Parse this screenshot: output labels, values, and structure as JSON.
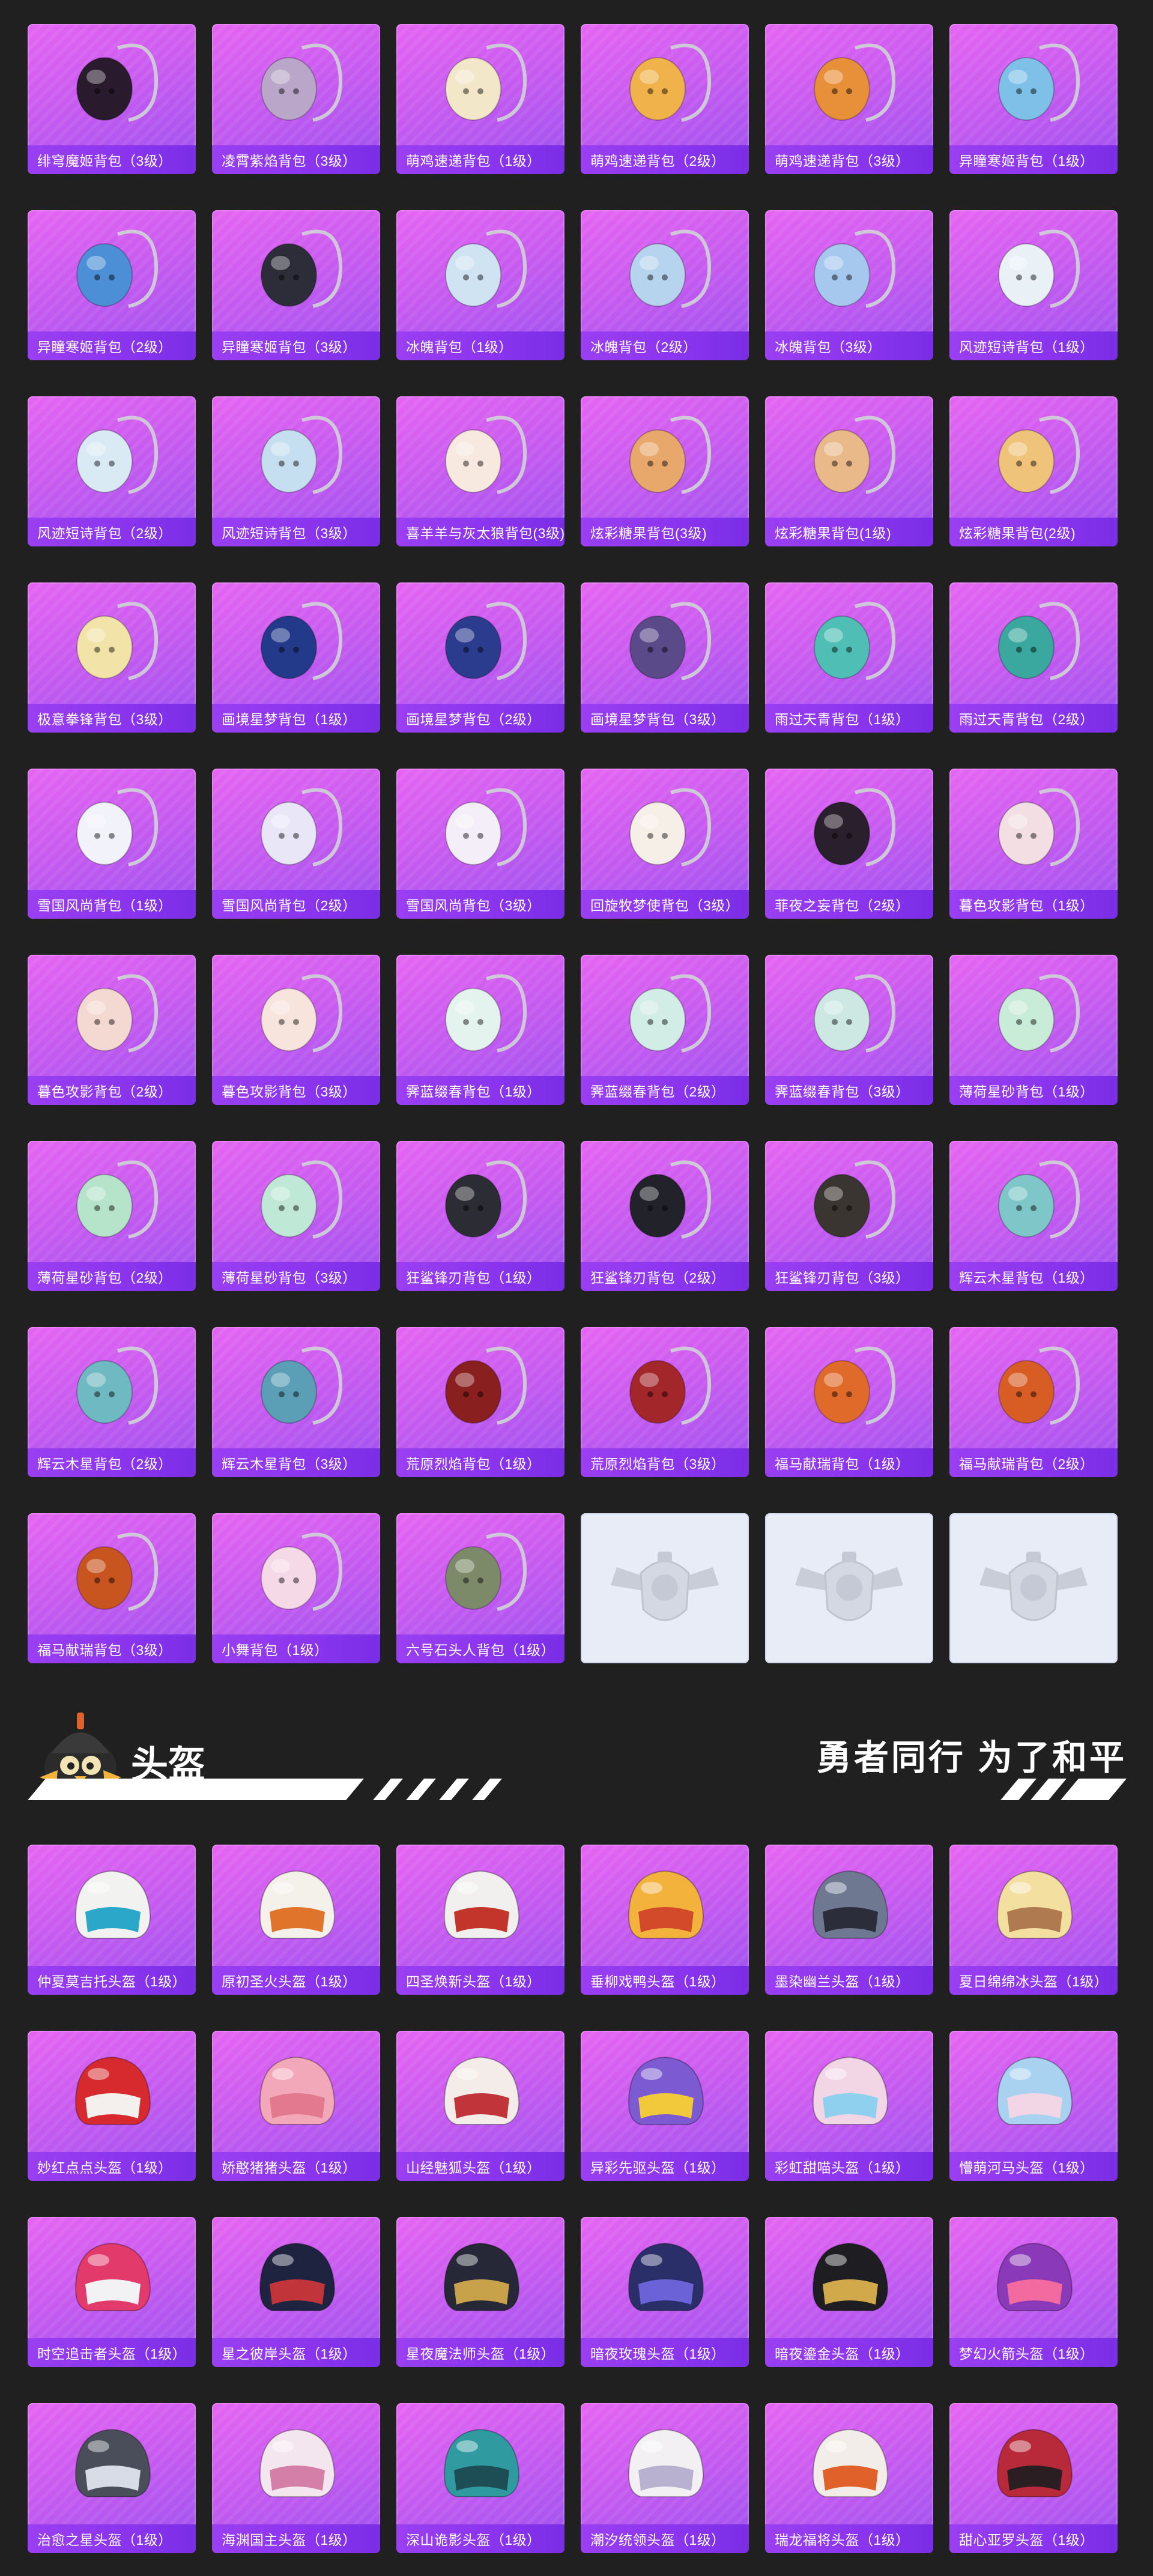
{
  "backpacks": [
    {
      "label": "绯穹魔姬背包（3级）",
      "icon": "backpack-demon-icon",
      "color": "#2a1a2e"
    },
    {
      "label": "凌霄紫焰背包（3级）",
      "icon": "backpack-shell-icon",
      "color": "#b9a6c8"
    },
    {
      "label": "萌鸡速递背包（1级）",
      "icon": "backpack-chick-icon",
      "color": "#f3e7c9"
    },
    {
      "label": "萌鸡速递背包（2级）",
      "icon": "backpack-chick-icon",
      "color": "#f0b24a"
    },
    {
      "label": "萌鸡速递背包（3级）",
      "icon": "backpack-chick-icon",
      "color": "#e88f3a"
    },
    {
      "label": "异瞳寒姬背包（1级）",
      "icon": "backpack-catsuit-icon",
      "color": "#7ec0e8"
    },
    {
      "label": "异瞳寒姬背包（2级）",
      "icon": "backpack-catsuit-icon",
      "color": "#4c8fd6"
    },
    {
      "label": "异瞳寒姬背包（3级）",
      "icon": "backpack-catsuit-icon",
      "color": "#2d2d3a"
    },
    {
      "label": "冰魄背包（1级）",
      "icon": "backpack-snowflake-icon",
      "color": "#cfe3f3"
    },
    {
      "label": "冰魄背包（2级）",
      "icon": "backpack-snowflake-icon",
      "color": "#b7d4ef"
    },
    {
      "label": "冰魄背包（3级）",
      "icon": "backpack-snowflake-icon",
      "color": "#a6c8ee"
    },
    {
      "label": "风迹短诗背包（1级）",
      "icon": "backpack-pouch-icon",
      "color": "#e9f1f7"
    },
    {
      "label": "风迹短诗背包（2级）",
      "icon": "backpack-pouch-icon",
      "color": "#d9eaf4"
    },
    {
      "label": "风迹短诗背包（3级）",
      "icon": "backpack-pouch-icon",
      "color": "#c6dff0"
    },
    {
      "label": "喜羊羊与灰太狼背包(3级)",
      "icon": "backpack-sheep-icon",
      "color": "#f7e9e0"
    },
    {
      "label": "炫彩糖果背包(3级)",
      "icon": "backpack-donut-icon",
      "color": "#e9a86b"
    },
    {
      "label": "炫彩糖果背包(1级)",
      "icon": "backpack-donut-icon",
      "color": "#e9b98a"
    },
    {
      "label": "炫彩糖果背包(2级)",
      "icon": "backpack-donut-icon",
      "color": "#f0c37a"
    },
    {
      "label": "极意拳锋背包（3级）",
      "icon": "backpack-cloud-icon",
      "color": "#f2e3a8"
    },
    {
      "label": "画境星梦背包（1级）",
      "icon": "backpack-book-icon",
      "color": "#233a8a"
    },
    {
      "label": "画境星梦背包（2级）",
      "icon": "backpack-book-icon",
      "color": "#2b3c8f"
    },
    {
      "label": "画境星梦背包（3级）",
      "icon": "backpack-book-icon",
      "color": "#5a4a8a"
    },
    {
      "label": "雨过天青背包（1级）",
      "icon": "backpack-drop-icon",
      "color": "#4fbfb5"
    },
    {
      "label": "雨过天青背包（2级）",
      "icon": "backpack-drop-icon",
      "color": "#3aa89f"
    },
    {
      "label": "雪国风尚背包（1级）",
      "icon": "backpack-bunny-icon",
      "color": "#f2f2fa"
    },
    {
      "label": "雪国风尚背包（2级）",
      "icon": "backpack-snowman-icon",
      "color": "#e8e6f7"
    },
    {
      "label": "雪国风尚背包（3级）",
      "icon": "backpack-snowman-icon",
      "color": "#f3eef8"
    },
    {
      "label": "回旋牧梦使背包（3级）",
      "icon": "backpack-lamb-icon",
      "color": "#f6efe7"
    },
    {
      "label": "菲夜之妄背包（2级）",
      "icon": "backpack-dark-icon",
      "color": "#2a1f2d"
    },
    {
      "label": "暮色攻影背包（1级）",
      "icon": "backpack-bat-icon",
      "color": "#f3dfe3"
    },
    {
      "label": "暮色攻影背包（2级）",
      "icon": "backpack-doll-icon",
      "color": "#f4d9d2"
    },
    {
      "label": "暮色攻影背包（3级）",
      "icon": "backpack-doll-icon",
      "color": "#f7e4dd"
    },
    {
      "label": "霁蓝缀春背包（1级）",
      "icon": "backpack-shield-icon",
      "color": "#e5f3ef"
    },
    {
      "label": "霁蓝缀春背包（2级）",
      "icon": "backpack-shield-icon",
      "color": "#d2ece6"
    },
    {
      "label": "霁蓝缀春背包（3级）",
      "icon": "backpack-shield-icon",
      "color": "#cde8e2"
    },
    {
      "label": "薄荷星砂背包（1级）",
      "icon": "backpack-mint-icon",
      "color": "#c9ecd8"
    },
    {
      "label": "薄荷星砂背包（2级）",
      "icon": "backpack-mint-icon",
      "color": "#b5e4cb"
    },
    {
      "label": "薄荷星砂背包（3级）",
      "icon": "backpack-mint-icon",
      "color": "#bfe8d6"
    },
    {
      "label": "狂鲨锋刃背包（1级）",
      "icon": "backpack-shark-icon",
      "color": "#2c2c34"
    },
    {
      "label": "狂鲨锋刃背包（2级）",
      "icon": "backpack-shark-icon",
      "color": "#22222a"
    },
    {
      "label": "狂鲨锋刃背包（3级）",
      "icon": "backpack-shark-icon",
      "color": "#3a3530"
    },
    {
      "label": "辉云木星背包（1级）",
      "icon": "backpack-planet-icon",
      "color": "#7ec6c8"
    },
    {
      "label": "辉云木星背包（2级）",
      "icon": "backpack-planet-icon",
      "color": "#6fb9c2"
    },
    {
      "label": "辉云木星背包（3级）",
      "icon": "backpack-planet-icon",
      "color": "#5a9fb6"
    },
    {
      "label": "荒原烈焰背包（1级）",
      "icon": "backpack-flame-icon",
      "color": "#8a1f1f"
    },
    {
      "label": "荒原烈焰背包（3级）",
      "icon": "backpack-flame-icon",
      "color": "#a3262a"
    },
    {
      "label": "福马献瑞背包（1级）",
      "icon": "backpack-horse-icon",
      "color": "#e06a2a"
    },
    {
      "label": "福马献瑞背包（2级）",
      "icon": "backpack-horse-icon",
      "color": "#d75d24"
    },
    {
      "label": "福马献瑞背包（3级）",
      "icon": "backpack-horse-icon",
      "color": "#c8541f"
    },
    {
      "label": "小舞背包（1级）",
      "icon": "backpack-rabbit-icon",
      "color": "#f6d9e6"
    },
    {
      "label": "六号石头人背包（1级）",
      "icon": "backpack-stone-icon",
      "color": "#7d8a6a"
    }
  ],
  "placeholders": [
    {
      "icon": "emblem-placeholder-icon"
    },
    {
      "icon": "emblem-placeholder-icon"
    },
    {
      "icon": "emblem-placeholder-icon"
    }
  ],
  "section": {
    "title": "头盔",
    "slogan": "勇者同行 为了和平",
    "mascot_icon": "helmet-mascot-icon"
  },
  "helmets": [
    {
      "label": "仲夏莫吉托头盔（1级）",
      "icon": "helmet-icon",
      "color": "#f2f2f0",
      "accent": "#2aa7c9"
    },
    {
      "label": "原初圣火头盔（1级）",
      "icon": "helmet-icon",
      "color": "#f4f1ea",
      "accent": "#e0742a"
    },
    {
      "label": "四圣焕新头盔（1级）",
      "icon": "helmet-icon",
      "color": "#f1f0ee",
      "accent": "#c3342a"
    },
    {
      "label": "垂柳戏鸭头盔（1级）",
      "icon": "helmet-icon",
      "color": "#f2b23c",
      "accent": "#d24a2a"
    },
    {
      "label": "墨染幽兰头盔（1级）",
      "icon": "helmet-icon",
      "color": "#6e7890",
      "accent": "#2b2e3a"
    },
    {
      "label": "夏日绵绵冰头盔（1级）",
      "icon": "helmet-icon",
      "color": "#f3e0a0",
      "accent": "#b07a50"
    },
    {
      "label": "妙红点点头盔（1级）",
      "icon": "helmet-icon",
      "color": "#d62a2f",
      "accent": "#f4f0ee"
    },
    {
      "label": "娇憨猪猪头盔（1级）",
      "icon": "helmet-icon",
      "color": "#f2a8b8",
      "accent": "#e2798f"
    },
    {
      "label": "山经魅狐头盔（1级）",
      "icon": "helmet-icon",
      "color": "#f3ece8",
      "accent": "#c0343a"
    },
    {
      "label": "异彩先驱头盔（1级）",
      "icon": "helmet-icon",
      "color": "#7b5ad2",
      "accent": "#f2c93a"
    },
    {
      "label": "彩虹甜喵头盔（1级）",
      "icon": "helmet-icon",
      "color": "#f2d6e6",
      "accent": "#8fd0ef"
    },
    {
      "label": "懵萌河马头盔（1级）",
      "icon": "helmet-icon",
      "color": "#a9d2f0",
      "accent": "#f3d6e6"
    },
    {
      "label": "时空追击者头盔（1级）",
      "icon": "helmet-icon",
      "color": "#e23a6a",
      "accent": "#f2f2f4"
    },
    {
      "label": "星之彼岸头盔（1级）",
      "icon": "helmet-icon",
      "color": "#1e2340",
      "accent": "#c0343a"
    },
    {
      "label": "星夜魔法师头盔（1级）",
      "icon": "helmet-icon",
      "color": "#262838",
      "accent": "#c8a24a"
    },
    {
      "label": "暗夜玫瑰头盔（1级）",
      "icon": "helmet-icon",
      "color": "#2a2f6a",
      "accent": "#6a62d6"
    },
    {
      "label": "暗夜鎏金头盔（1级）",
      "icon": "helmet-icon",
      "color": "#1e1e22",
      "accent": "#d2a94a"
    },
    {
      "label": "梦幻火箭头盔（1级）",
      "icon": "helmet-icon",
      "color": "#8a3ab8",
      "accent": "#f26aa0"
    },
    {
      "label": "治愈之星头盔（1级）",
      "icon": "helmet-icon",
      "color": "#4a4d5a",
      "accent": "#d8dce6"
    },
    {
      "label": "海渊国主头盔（1级）",
      "icon": "helmet-icon",
      "color": "#f4e6ee",
      "accent": "#d47fa8"
    },
    {
      "label": "深山诡影头盔（1级）",
      "icon": "helmet-icon",
      "color": "#2f9aa0",
      "accent": "#1d4d55"
    },
    {
      "label": "潮汐统领头盔（1级）",
      "icon": "helmet-icon",
      "color": "#f3f0f4",
      "accent": "#b8b2d0"
    },
    {
      "label": "瑞龙福将头盔（1级）",
      "icon": "helmet-icon",
      "color": "#f2ede8",
      "accent": "#e0622a"
    },
    {
      "label": "甜心亚罗头盔（1级）",
      "icon": "helmet-icon",
      "color": "#b82a3a",
      "accent": "#2a1e22"
    }
  ]
}
